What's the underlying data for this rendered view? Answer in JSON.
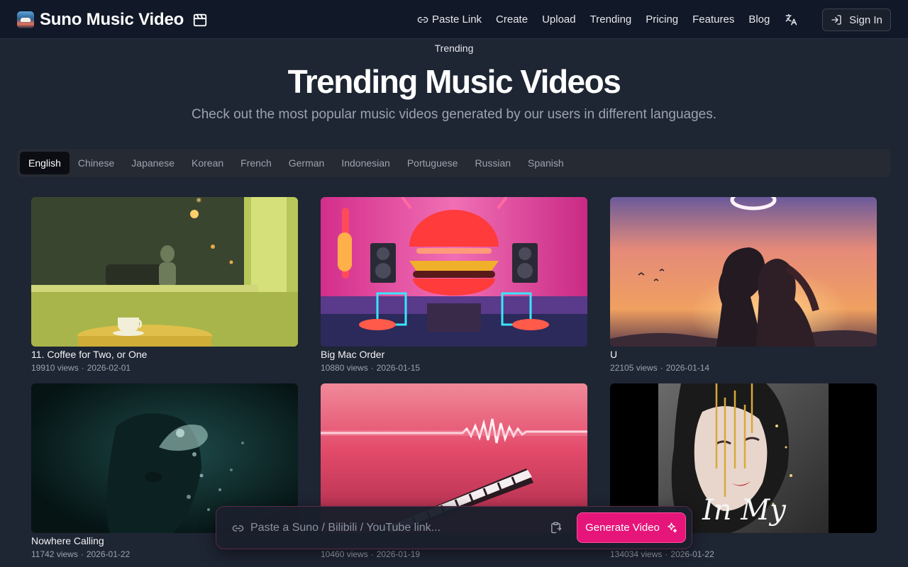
{
  "brand": {
    "name": "Suno Music Video"
  },
  "nav": {
    "items": [
      "Paste Link",
      "Create",
      "Upload",
      "Trending",
      "Pricing",
      "Features",
      "Blog"
    ],
    "sign_in": "Sign In"
  },
  "hero": {
    "eyebrow": "Trending",
    "title": "Trending Music Videos",
    "subtitle": "Check out the most popular music videos generated by our users in different languages."
  },
  "tabs": {
    "items": [
      "English",
      "Chinese",
      "Japanese",
      "Korean",
      "French",
      "German",
      "Indonesian",
      "Portuguese",
      "Russian",
      "Spanish"
    ],
    "active": "English"
  },
  "videos": [
    {
      "title": "11. Coffee for Two, or One",
      "views": "19910 views",
      "date": "2026-02-01"
    },
    {
      "title": "Big Mac Order",
      "views": "10880 views",
      "date": "2026-01-15"
    },
    {
      "title": "U",
      "views": "22105 views",
      "date": "2026-01-14"
    },
    {
      "title": "Nowhere Calling",
      "views": "11742 views",
      "date": "2026-01-22"
    },
    {
      "title": "",
      "views": "10460 views",
      "date": "2026-01-19"
    },
    {
      "title": "",
      "views": "134034 views",
      "date": "2026-01-22"
    }
  ],
  "thumbnail_overlay_text": {
    "video6": "In My"
  },
  "generator": {
    "placeholder": "Paste a Suno / Bilibili / YouTube link...",
    "button": "Generate Video"
  },
  "colors": {
    "background": "#1e2533",
    "header": "#111827",
    "accent": "#e6157a",
    "active_tab": "#0b0d12"
  }
}
